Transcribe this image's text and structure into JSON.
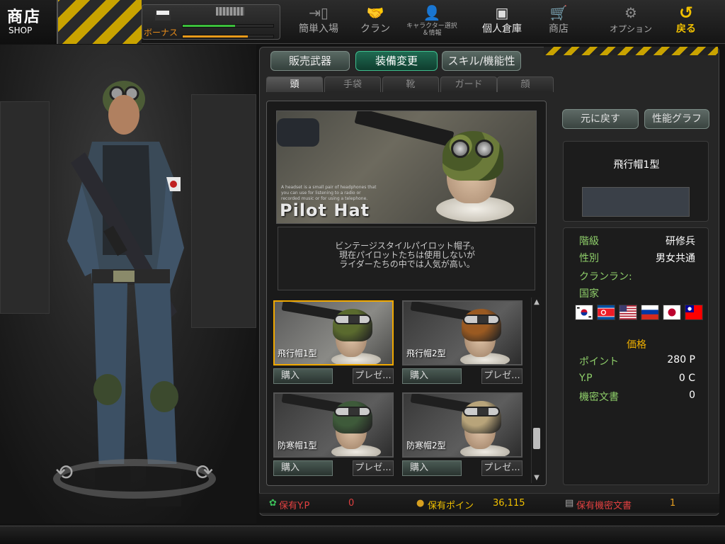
{
  "header": {
    "shop_title": "商店",
    "shop_subtitle": "SHOP",
    "bonus_label": "ボーナス",
    "exp_fraction": 0.58,
    "bonus_fraction": 0.72
  },
  "nav": {
    "quick_join": {
      "label": "簡単入場",
      "icon": "door-enter-icon"
    },
    "clan": {
      "label": "クラン",
      "icon": "handshake-icon"
    },
    "character": {
      "label_line1": "キャラクター選択",
      "label_line2": "＆情報",
      "icon": "person-icon"
    },
    "inventory": {
      "label": "個人倉庫",
      "icon": "locker-icon"
    },
    "shop": {
      "label": "商店",
      "icon": "cart-icon"
    },
    "options": {
      "label": "オプション",
      "icon": "gear-icon"
    },
    "back": {
      "label": "戻る",
      "icon": "back-arrow-icon"
    }
  },
  "categories": [
    "販売武器",
    "装備変更",
    "スキル/機能性"
  ],
  "subtabs": [
    "頭",
    "手袋",
    "靴",
    "ガード",
    "顔"
  ],
  "preview": {
    "title": "Pilot Hat",
    "fine_print": "A headset is a small pair of headphones that you can use for listening to a radio or recorded music or for using a telephone.",
    "description": "ビンテージスタイルパイロット帽子。\n現在パイロットたちは使用しないが\nライダーたちの中では人気が高い。"
  },
  "items": [
    {
      "name": "飛行帽1型",
      "buy": "購入",
      "gift": "プレゼ...",
      "hat_color": "#5a6a2e"
    },
    {
      "name": "飛行帽2型",
      "buy": "購入",
      "gift": "プレゼ...",
      "hat_color": "#9a5a22"
    },
    {
      "name": "防寒帽1型",
      "buy": "購入",
      "gift": "プレゼ...",
      "hat_color": "#3e5a3a"
    },
    {
      "name": "防寒帽2型",
      "buy": "購入",
      "gift": "プレゼ...",
      "hat_color": "#b8a47a"
    }
  ],
  "actions": {
    "revert": "元に戻す",
    "graph": "性能グラフ"
  },
  "detail": {
    "name": "飛行帽1型",
    "rank_label": "階級",
    "rank_value": "研修兵",
    "gender_label": "性別",
    "gender_value": "男女共通",
    "clan_label": "クランラン:",
    "country_label": "国家",
    "price_label": "価格",
    "point_label": "ポイント",
    "point_value": "280 P",
    "yp_label": "Y.P",
    "yp_value": "0 C",
    "secret_label": "機密文書",
    "secret_value": "0"
  },
  "flags": [
    "kr",
    "kp",
    "us",
    "ru",
    "jp",
    "tw"
  ],
  "currency": {
    "yp_label": "保有Y.P",
    "yp_value": "0",
    "points_label": "保有ポイン",
    "points_value": "36,115",
    "secret_label": "保有機密文書",
    "secret_value": "1"
  },
  "colors": {
    "accent_gold": "#f0c000",
    "selected_border": "#f0a800",
    "active_tab": "#1f6b52",
    "label_green": "#8fcf6a",
    "currency_red": "#e04040"
  }
}
